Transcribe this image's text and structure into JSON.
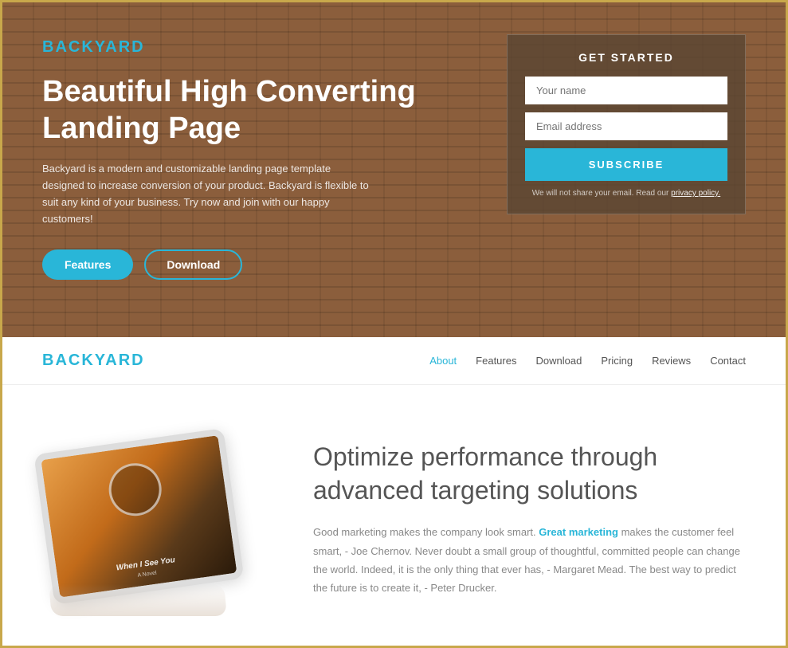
{
  "hero": {
    "logo": {
      "prefix": "BACK",
      "highlight": "Y",
      "suffix": "ARD"
    },
    "title": "Beautiful High Converting Landing Page",
    "description": "Backyard is a modern and customizable landing page template designed to increase conversion of your product. Backyard is flexible to suit any kind of your business. Try now and join with our happy customers!",
    "btn_features": "Features",
    "btn_download": "Download"
  },
  "form": {
    "title": "GET STARTED",
    "name_placeholder": "Your name",
    "email_placeholder": "Email address",
    "subscribe_label": "SUBSCRIBE",
    "disclaimer": "We will not share your email. Read our",
    "privacy_link": "privacy policy."
  },
  "navbar": {
    "logo": {
      "prefix": "BACK",
      "highlight": "Y",
      "suffix": "ARD"
    },
    "links": [
      {
        "label": "About",
        "active": true
      },
      {
        "label": "Features",
        "active": false
      },
      {
        "label": "Download",
        "active": false
      },
      {
        "label": "Pricing",
        "active": false
      },
      {
        "label": "Reviews",
        "active": false
      },
      {
        "label": "Contact",
        "active": false
      }
    ]
  },
  "content": {
    "tablet": {
      "book_title": "When I See You",
      "book_subtitle": "A Novel"
    },
    "title": "Optimize performance through advanced targeting solutions",
    "body_start": "Good marketing makes the company look smart.",
    "body_link": "Great marketing",
    "body_end": " makes the customer feel smart, - Joe Chernov. Never doubt a small group of thoughtful, committed people can change the world. Indeed, it is the only thing that ever has, - Margaret Mead. The best way to predict the future is to create it, - Peter Drucker."
  }
}
